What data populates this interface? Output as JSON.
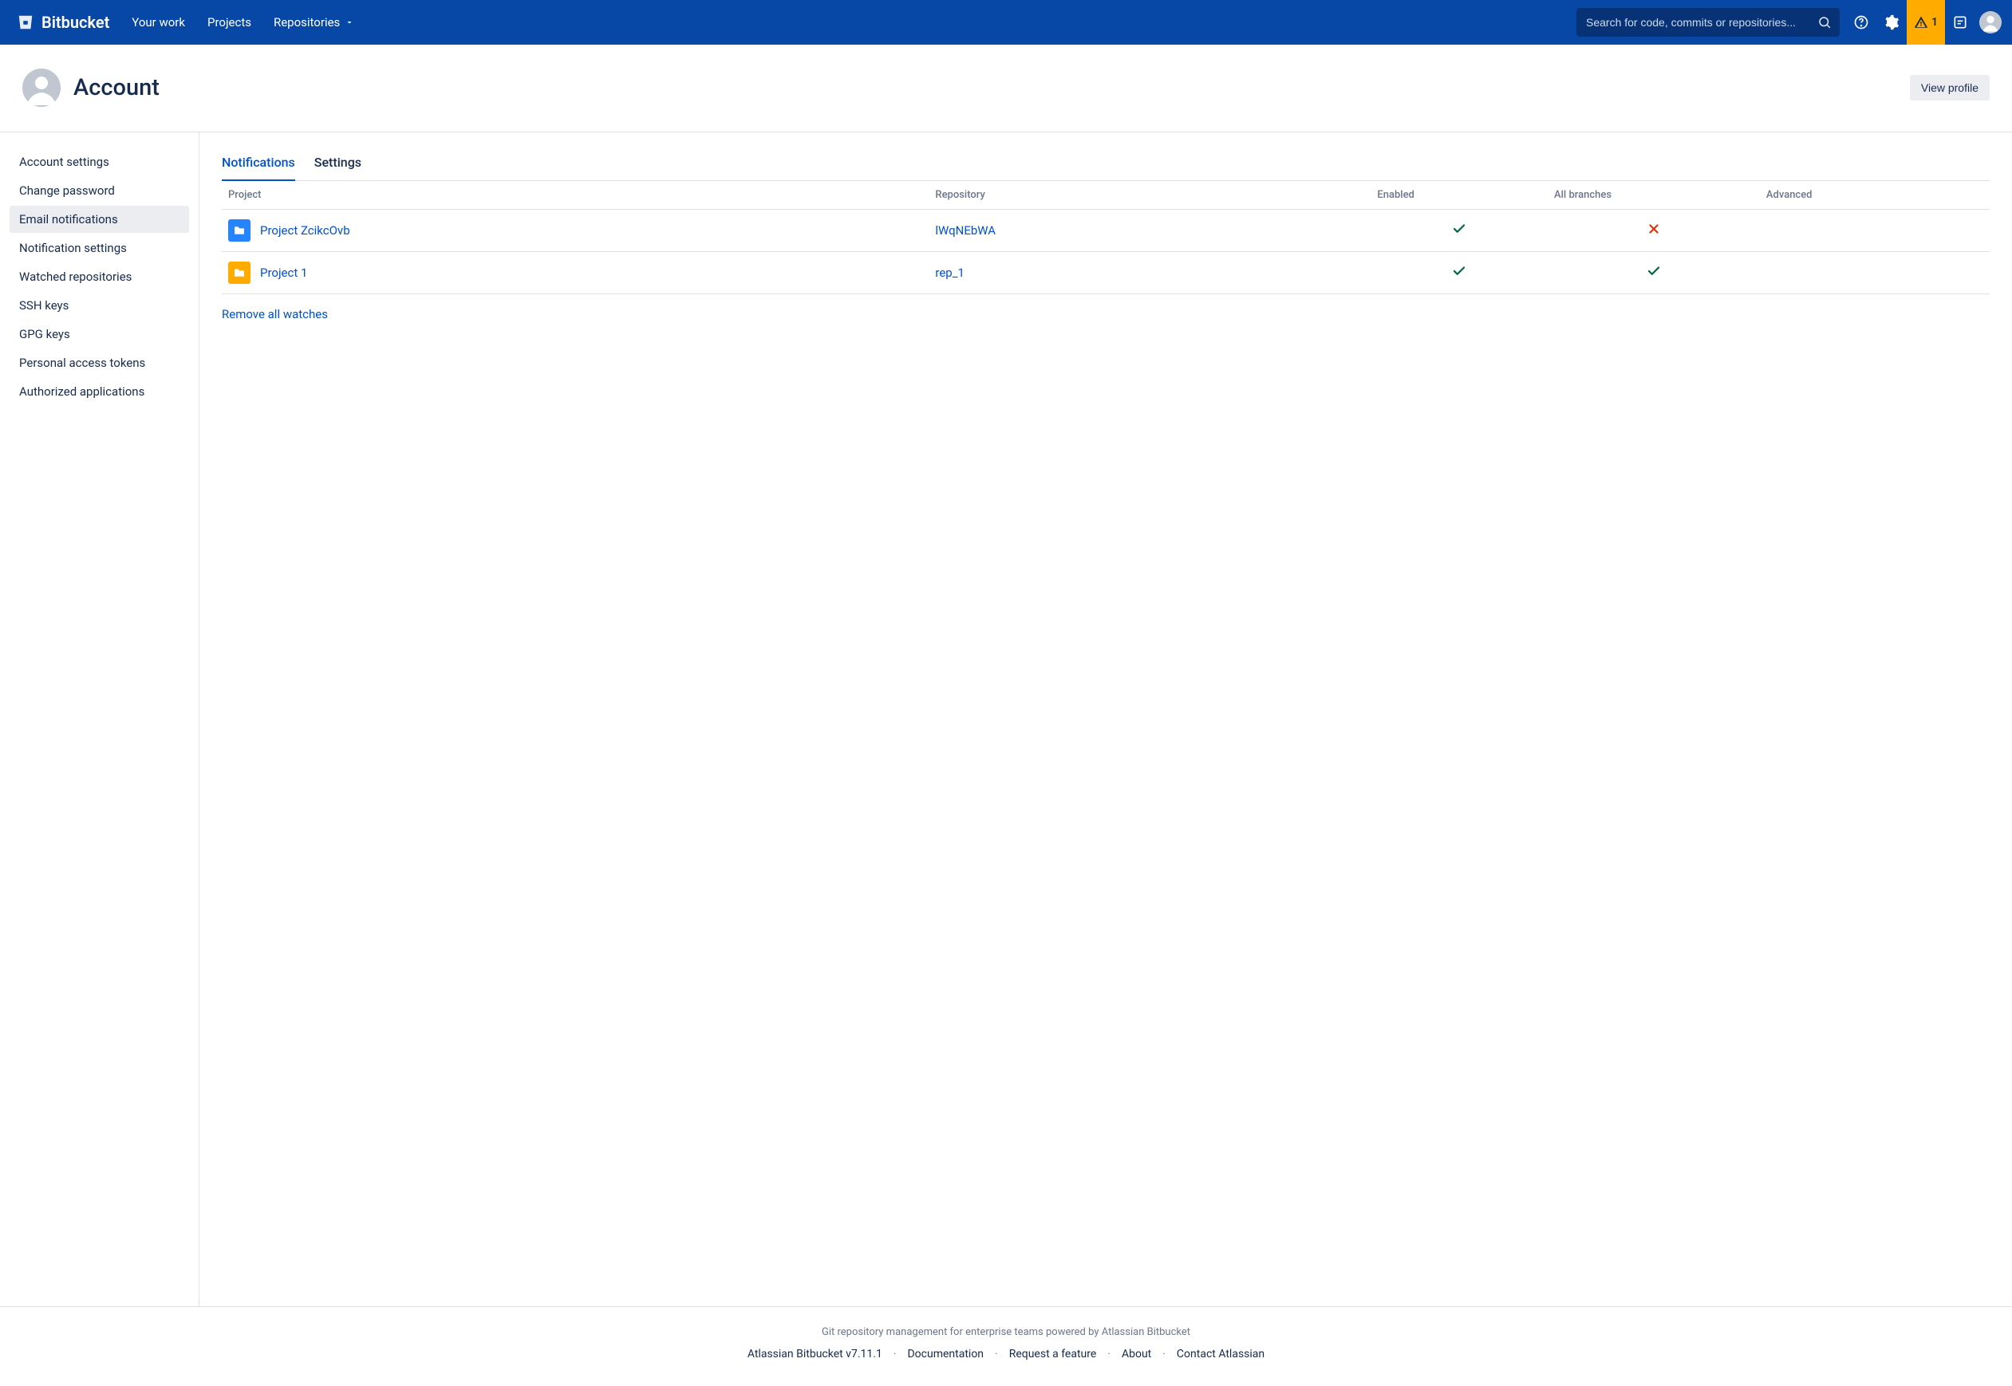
{
  "brand": "Bitbucket",
  "nav": {
    "your_work": "Your work",
    "projects": "Projects",
    "repositories": "Repositories"
  },
  "search": {
    "placeholder": "Search for code, commits or repositories..."
  },
  "alerts": {
    "count": "1"
  },
  "header": {
    "title": "Account",
    "view_profile": "View profile"
  },
  "sidebar": {
    "items": [
      "Account settings",
      "Change password",
      "Email notifications",
      "Notification settings",
      "Watched repositories",
      "SSH keys",
      "GPG keys",
      "Personal access tokens",
      "Authorized applications"
    ],
    "active_index": 2
  },
  "tabs": {
    "notifications": "Notifications",
    "settings": "Settings"
  },
  "table": {
    "headers": {
      "project": "Project",
      "repository": "Repository",
      "enabled": "Enabled",
      "all_branches": "All branches",
      "advanced": "Advanced"
    },
    "rows": [
      {
        "project": "Project ZcikcOvb",
        "icon_color": "blue",
        "repository": "lWqNEbWA",
        "enabled": true,
        "all_branches": false
      },
      {
        "project": "Project 1",
        "icon_color": "yellow",
        "repository": "rep_1",
        "enabled": true,
        "all_branches": true
      }
    ]
  },
  "remove_all": "Remove all watches",
  "footer": {
    "tagline": "Git repository management for enterprise teams powered by Atlassian Bitbucket",
    "version": "Atlassian Bitbucket v7.11.1",
    "documentation": "Documentation",
    "request_feature": "Request a feature",
    "about": "About",
    "contact": "Contact Atlassian"
  }
}
